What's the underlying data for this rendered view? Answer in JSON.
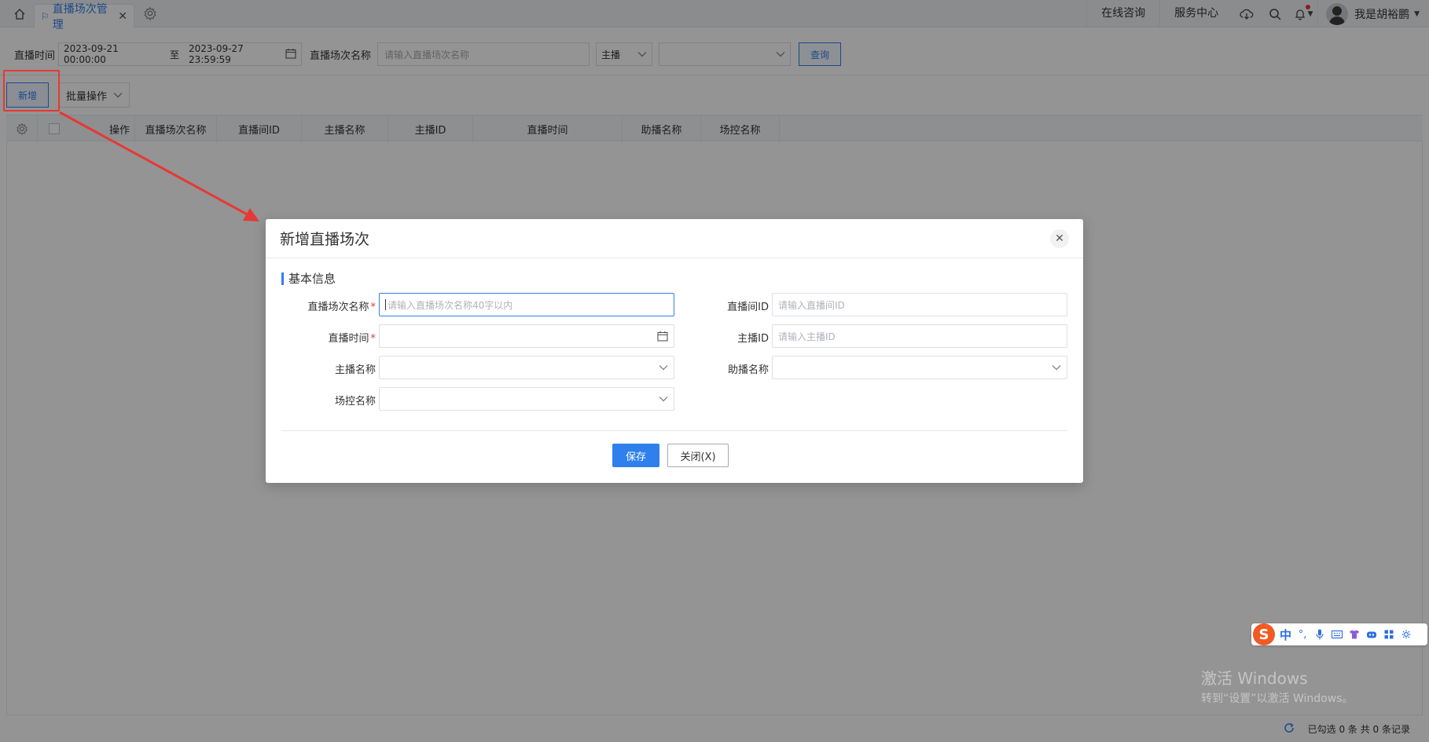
{
  "topbar": {
    "tab_label": "直播场次管理",
    "tab_close": "✕",
    "links": [
      "在线咨询",
      "服务中心"
    ],
    "user_name": "我是胡裕鹏"
  },
  "filter": {
    "time_label": "直播时间",
    "date_start": "2023-09-21 00:00:00",
    "date_sep": "至",
    "date_end": "2023-09-27 23:59:59",
    "name_label": "直播场次名称",
    "name_placeholder": "请输入直播场次名称",
    "select1_value": "主播",
    "select2_value": "",
    "query_button": "查询"
  },
  "toolbar": {
    "add_button": "新增",
    "batch_button": "批量操作"
  },
  "table": {
    "columns": [
      "操作",
      "直播场次名称",
      "直播间ID",
      "主播名称",
      "主播ID",
      "直播时间",
      "助播名称",
      "场控名称"
    ]
  },
  "footer": {
    "summary": "已勾选 0 条  共 0 条记录"
  },
  "modal": {
    "title": "新增直播场次",
    "section_title": "基本信息",
    "fields": {
      "session_name_label": "直播场次名称",
      "session_name_placeholder": "请输入直播场次名称40字以内",
      "live_time_label": "直播时间",
      "anchor_name_label": "主播名称",
      "control_name_label": "场控名称",
      "room_id_label": "直播间ID",
      "room_id_placeholder": "请输入直播间ID",
      "anchor_id_label": "主播ID",
      "anchor_id_placeholder": "请输入主播ID",
      "assistant_name_label": "助播名称",
      "required_mark": "*"
    },
    "save_button": "保存",
    "close_button": "关闭(X)"
  },
  "ime": {
    "logo": "S",
    "mode": "中",
    "punct": "°,"
  },
  "watermark": {
    "line1": "激活 Windows",
    "line2": "转到“设置”以激活 Windows。"
  },
  "colors": {
    "accent": "#2f80ed",
    "highlight_red": "#e53935"
  }
}
